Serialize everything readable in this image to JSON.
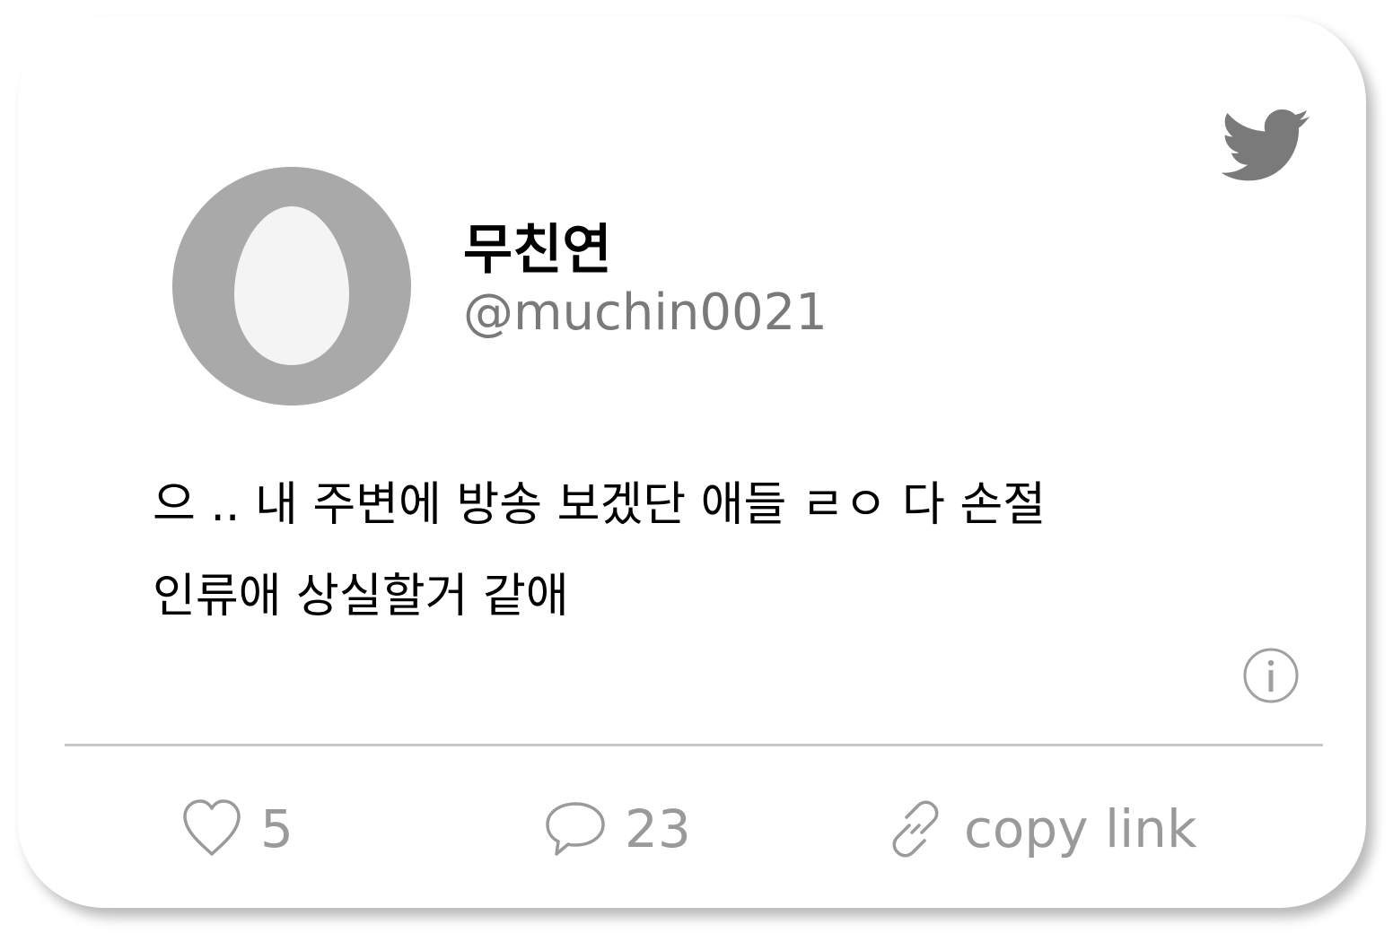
{
  "colors": {
    "card_background": "#ffffff",
    "name_color": "#000000",
    "handle_color": "#7a7a7a",
    "icon_gray": "#7a7a7a",
    "action_gray": "#9a9a9a",
    "avatar_ring": "#a9a9a9",
    "avatar_egg": "#f4f4f4",
    "divider": "#c8c8c8"
  },
  "header": {
    "logo_icon": "twitter-bird-icon",
    "avatar_icon": "default-egg-avatar"
  },
  "user": {
    "display_name": "무친연",
    "handle": "@muchin0021"
  },
  "tweet": {
    "lines": [
      "으 .. 내 주변에 방송 보겠단 애들 ㄹㅇ 다 손절",
      "인류애 상실할거 같애"
    ]
  },
  "info": {
    "icon": "info-icon"
  },
  "actions": {
    "like": {
      "icon": "heart-icon",
      "count": "5"
    },
    "reply": {
      "icon": "speech-bubble-icon",
      "count": "23"
    },
    "copy_link": {
      "icon": "link-icon",
      "label": "copy link"
    }
  }
}
